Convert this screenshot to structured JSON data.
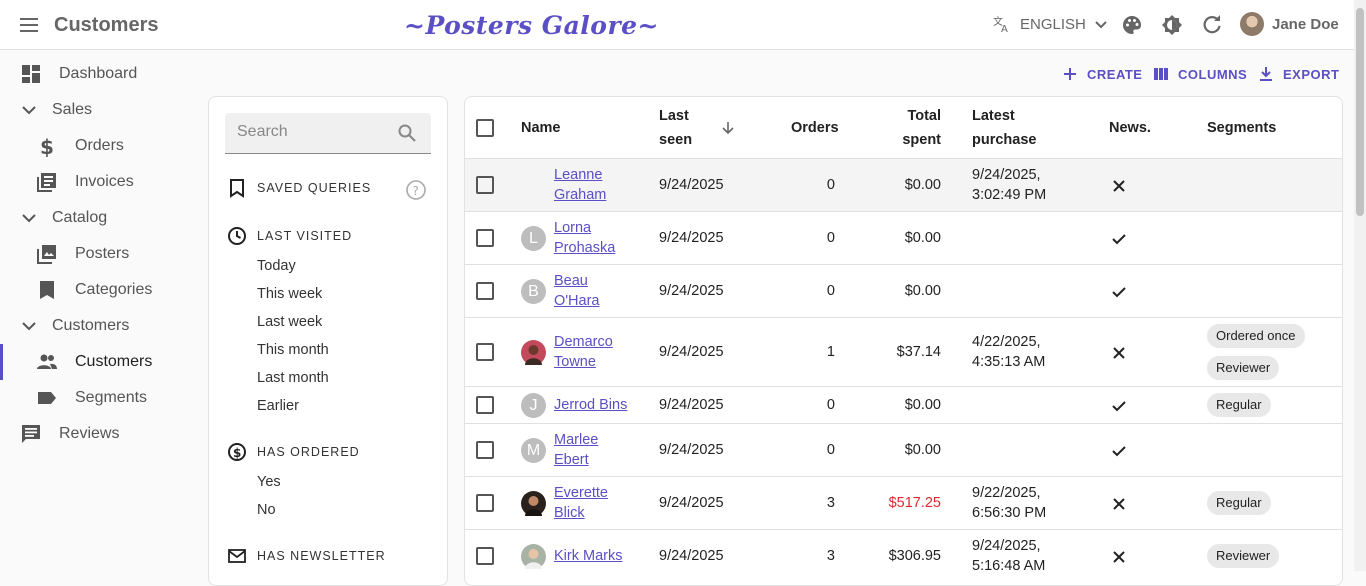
{
  "app": {
    "title": "Customers",
    "brand": "~Posters Galore~",
    "language": "ENGLISH",
    "user": "Jane Doe"
  },
  "sidebar": {
    "items": [
      {
        "label": "Dashboard"
      },
      {
        "label": "Sales"
      },
      {
        "label": "Orders"
      },
      {
        "label": "Invoices"
      },
      {
        "label": "Catalog"
      },
      {
        "label": "Posters"
      },
      {
        "label": "Categories"
      },
      {
        "label": "Customers"
      },
      {
        "label": "Customers"
      },
      {
        "label": "Segments"
      },
      {
        "label": "Reviews"
      }
    ]
  },
  "filters": {
    "search_placeholder": "Search",
    "saved_queries": "SAVED QUERIES",
    "last_visited": "LAST VISITED",
    "last_visited_items": [
      "Today",
      "This week",
      "Last week",
      "This month",
      "Last month",
      "Earlier"
    ],
    "has_ordered": "HAS ORDERED",
    "has_ordered_items": [
      "Yes",
      "No"
    ],
    "has_newsletter": "HAS NEWSLETTER"
  },
  "actions": {
    "create": "CREATE",
    "columns": "COLUMNS",
    "export": "EXPORT"
  },
  "table": {
    "headers": {
      "name": "Name",
      "last_seen_1": "Last",
      "last_seen_2": "seen",
      "orders": "Orders",
      "total_1": "Total",
      "total_2": "spent",
      "latest_1": "Latest",
      "latest_2": "purchase",
      "news": "News.",
      "segments": "Segments"
    },
    "rows": [
      {
        "name1": "Leanne",
        "name2": "Graham",
        "initial": "",
        "avatar_color": "",
        "last_seen": "9/24/2025",
        "orders": "0",
        "total": "$0.00",
        "total_color": "#222222",
        "latest1": "9/24/2025,",
        "latest2": "3:02:49 PM",
        "newsletter": false,
        "chips": []
      },
      {
        "name1": "Lorna",
        "name2": "Prohaska",
        "initial": "L",
        "avatar_color": "#bdbdbd",
        "last_seen": "9/24/2025",
        "orders": "0",
        "total": "$0.00",
        "total_color": "#222222",
        "latest1": "",
        "latest2": "",
        "newsletter": true,
        "chips": []
      },
      {
        "name1": "Beau",
        "name2": "O'Hara",
        "initial": "B",
        "avatar_color": "#bdbdbd",
        "last_seen": "9/24/2025",
        "orders": "0",
        "total": "$0.00",
        "total_color": "#222222",
        "latest1": "",
        "latest2": "",
        "newsletter": true,
        "chips": []
      },
      {
        "name1": "Demarco",
        "name2": "Towne",
        "initial": "",
        "avatar_color": "#c24a5c",
        "last_seen": "9/24/2025",
        "orders": "1",
        "total": "$37.14",
        "total_color": "#222222",
        "latest1": "4/22/2025,",
        "latest2": "4:35:13 AM",
        "newsletter": false,
        "chips": [
          "Ordered once",
          "Reviewer"
        ]
      },
      {
        "name1": "Jerrod Bins",
        "name2": "",
        "initial": "J",
        "avatar_color": "#bdbdbd",
        "last_seen": "9/24/2025",
        "orders": "0",
        "total": "$0.00",
        "total_color": "#222222",
        "latest1": "",
        "latest2": "",
        "newsletter": true,
        "chips": [
          "Regular"
        ]
      },
      {
        "name1": "Marlee",
        "name2": "Ebert",
        "initial": "M",
        "avatar_color": "#bdbdbd",
        "last_seen": "9/24/2025",
        "orders": "0",
        "total": "$0.00",
        "total_color": "#222222",
        "latest1": "",
        "latest2": "",
        "newsletter": true,
        "chips": []
      },
      {
        "name1": "Everette",
        "name2": "Blick",
        "initial": "",
        "avatar_color": "#2b211c",
        "last_seen": "9/24/2025",
        "orders": "3",
        "total": "$517.25",
        "total_color": "#e0282e",
        "latest1": "9/22/2025,",
        "latest2": "6:56:30 PM",
        "newsletter": false,
        "chips": [
          "Regular"
        ]
      },
      {
        "name1": "Kirk Marks",
        "name2": "",
        "initial": "",
        "avatar_color": "#a9b3a5",
        "last_seen": "9/24/2025",
        "orders": "3",
        "total": "$306.95",
        "total_color": "#222222",
        "latest1": "9/24/2025,",
        "latest2": "5:16:48 AM",
        "newsletter": false,
        "chips": [
          "Reviewer"
        ]
      }
    ]
  }
}
